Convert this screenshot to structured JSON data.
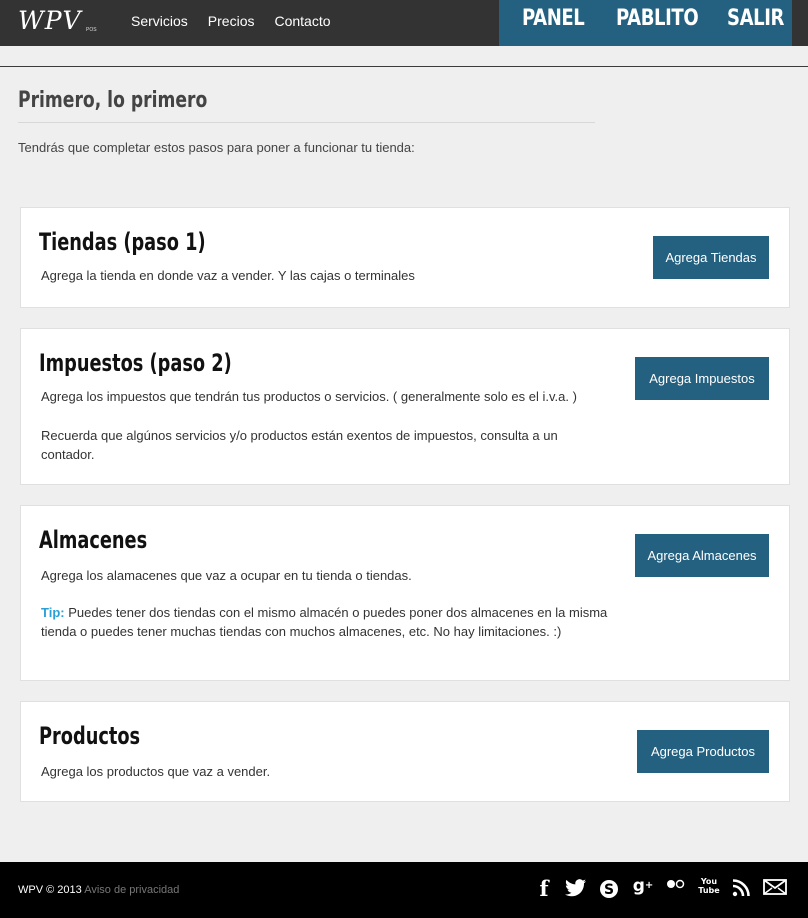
{
  "header": {
    "logo_text": "WPV",
    "logo_sub": "POS",
    "nav": [
      "Servicios",
      "Precios",
      "Contacto"
    ],
    "user_links": [
      "PANEL",
      "PABLITO",
      "SALIR"
    ]
  },
  "main": {
    "title": "Primero, lo primero",
    "intro": "Tendrás que completar estos pasos para poner a funcionar tu tienda:",
    "steps": [
      {
        "title": "Tiendas (paso 1)",
        "text": "Agrega la tienda en donde vaz a vender. Y las cajas o terminales",
        "button": "Agrega Tiendas"
      },
      {
        "title": "Impuestos (paso 2)",
        "text": "Agrega los impuestos que tendrán tus productos o servicios. ( generalmente solo es el i.v.a. )",
        "text2": "Recuerda que algúnos servicios y/o productos están exentos de impuestos, consulta a un contador.",
        "button": "Agrega Impuestos"
      },
      {
        "title": "Almacenes",
        "text": "Agrega los alamacenes que vaz a ocupar en tu tienda o tiendas.",
        "tip_label": "Tip:",
        "tip_text": " Puedes tener dos tiendas con el mismo almacén o puedes poner dos almacenes en la misma tienda o puedes tener muchas tiendas con muchos almacenes, etc. No hay limitaciones. :)",
        "button": "Agrega Almacenes"
      },
      {
        "title": "Productos",
        "text": "Agrega los productos que vaz a vender.",
        "button": "Agrega Productos"
      }
    ]
  },
  "footer": {
    "copyright": "WPV © 2013",
    "privacy": "Aviso de privacidad",
    "social_icons": [
      "facebook-icon",
      "twitter-icon",
      "skype-icon",
      "google-plus-icon",
      "flickr-icon",
      "youtube-icon",
      "rss-icon",
      "email-icon"
    ],
    "youtube_label": "You Tube"
  },
  "colors": {
    "topbar": "#333333",
    "accent": "#24607f",
    "tip": "#2a9fd6",
    "background": "#efefef",
    "footer": "#000000"
  }
}
